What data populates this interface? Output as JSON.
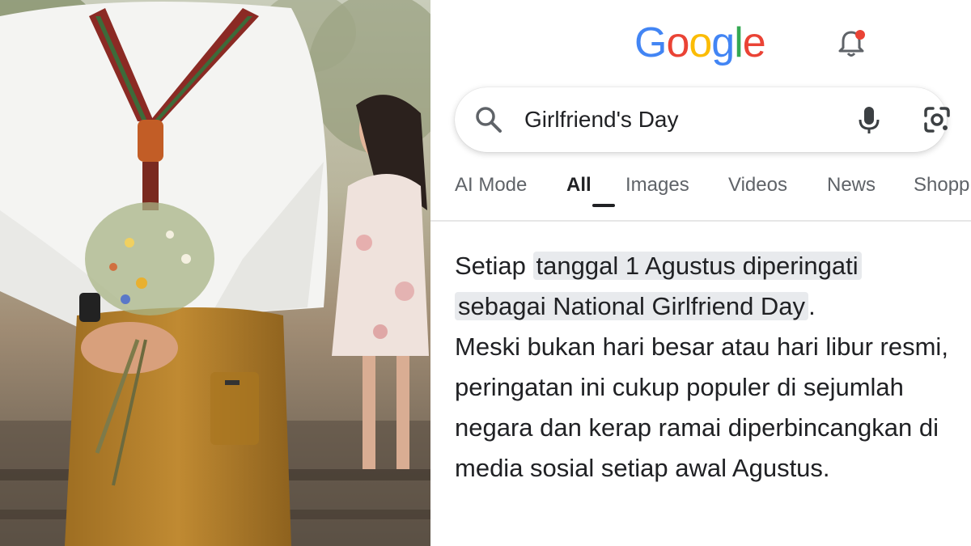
{
  "photo": {
    "alt_icon": "couple-flowers-photo"
  },
  "google": {
    "logo_letters": [
      "G",
      "o",
      "o",
      "g",
      "l",
      "e"
    ],
    "logo_colors": [
      "#4285F4",
      "#EA4335",
      "#FBBC05",
      "#4285F4",
      "#34A853",
      "#EA4335"
    ],
    "notification_dot_color": "#EA4335"
  },
  "search": {
    "query": "Girlfriend's Day"
  },
  "tabs": [
    {
      "label": "AI Mode",
      "active": false
    },
    {
      "label": "All",
      "active": true
    },
    {
      "label": "Images",
      "active": false
    },
    {
      "label": "Videos",
      "active": false
    },
    {
      "label": "News",
      "active": false
    },
    {
      "label": "Shopp",
      "active": false
    }
  ],
  "answer": {
    "lead": "Setiap ",
    "highlight_1": "tanggal 1 Agustus diperingati",
    "highlight_2": "sebagai National Girlfriend Day",
    "after_highlight": ".",
    "body": "Meski bukan hari besar atau hari libur resmi, peringatan ini cukup populer di sejumlah negara dan kerap ramai diperbincangkan di media sosial setiap awal Agustus."
  }
}
